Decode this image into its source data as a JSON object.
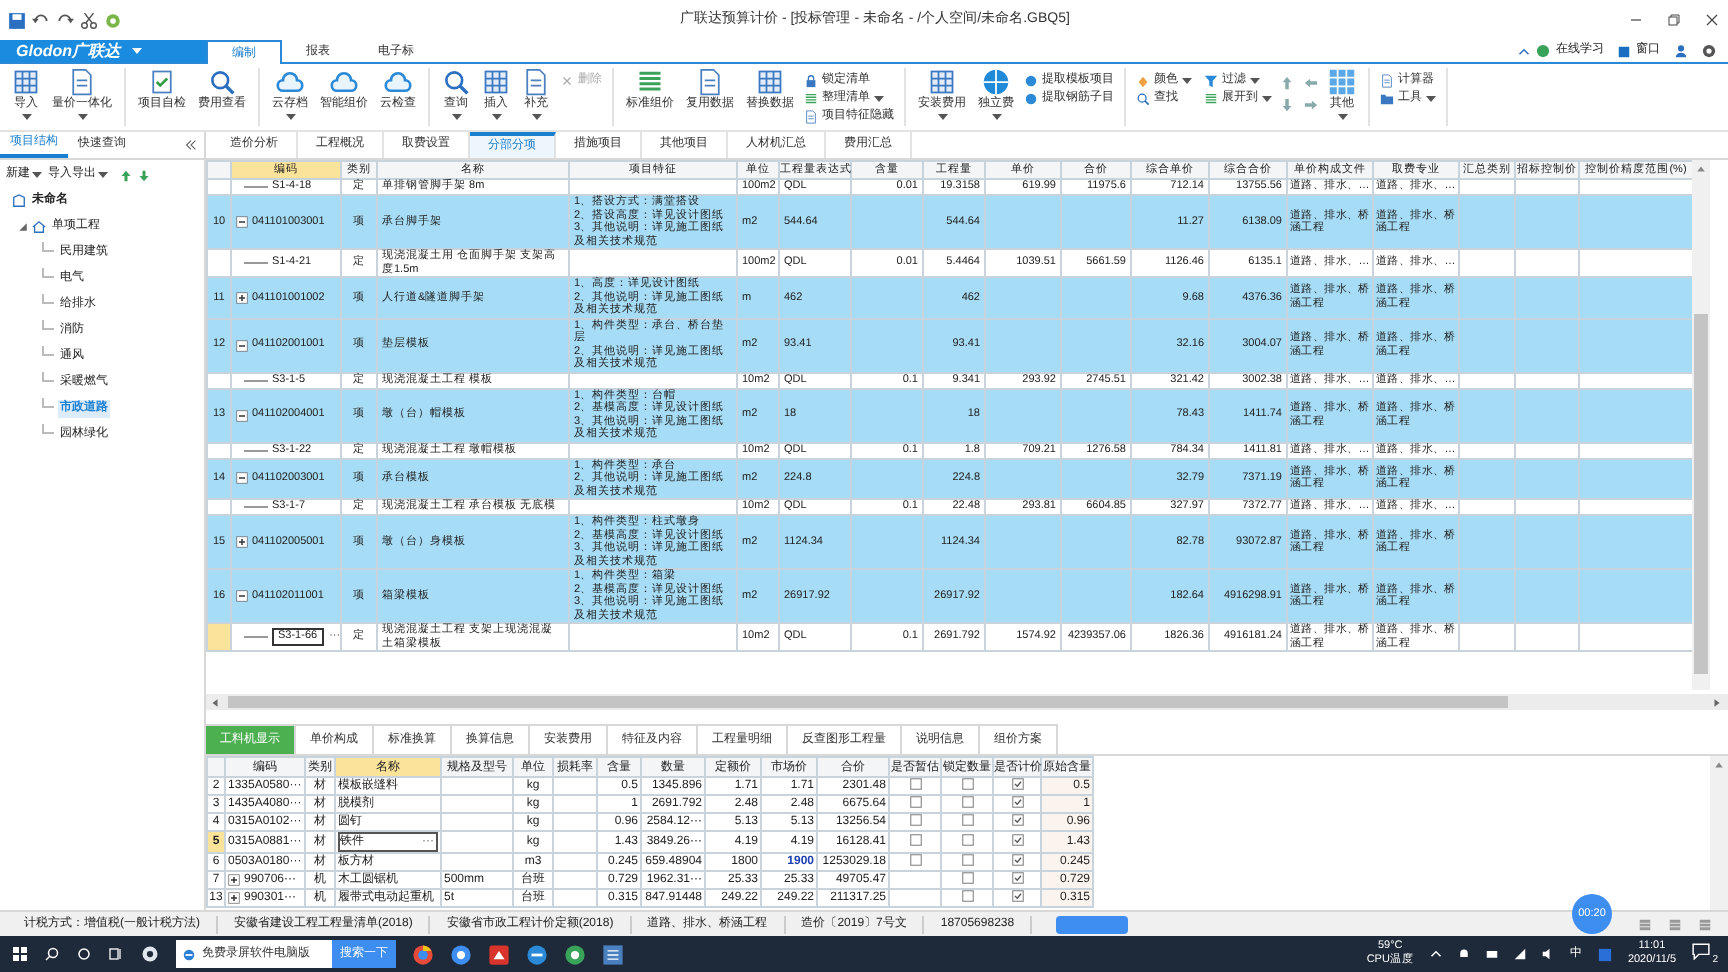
{
  "window": {
    "title": "广联达预算计价 - [投标管理 - 未命名 - /个人空间/未命名.GBQ5]"
  },
  "logo": "Glodon广联达",
  "menu_tabs": [
    {
      "label": "编制",
      "selected": true
    },
    {
      "label": "报表",
      "selected": false
    },
    {
      "label": "电子标",
      "selected": false
    }
  ],
  "help_bar": {
    "online_learning": "在线学习",
    "window_menu": "窗口"
  },
  "ribbon": {
    "groups": [
      {
        "buttons": [
          {
            "label": "导入",
            "kind": "large",
            "dropdown": true,
            "disabled": false
          },
          {
            "label": "量价一体化",
            "kind": "large",
            "dropdown": true,
            "disabled": false
          }
        ]
      },
      {
        "buttons": [
          {
            "label": "项目自检",
            "kind": "large",
            "dropdown": false,
            "disabled": false
          },
          {
            "label": "费用查看",
            "kind": "large",
            "dropdown": false,
            "disabled": false
          }
        ]
      },
      {
        "buttons": [
          {
            "label": "云存档",
            "kind": "large",
            "dropdown": true,
            "disabled": false
          },
          {
            "label": "智能组价",
            "kind": "large",
            "dropdown": false,
            "disabled": false
          },
          {
            "label": "云检查",
            "kind": "large",
            "dropdown": false,
            "disabled": false
          }
        ]
      },
      {
        "buttons": [
          {
            "label": "查询",
            "kind": "large",
            "dropdown": true,
            "disabled": false
          },
          {
            "label": "插入",
            "kind": "large",
            "dropdown": true,
            "disabled": false
          },
          {
            "label": "补充",
            "kind": "large",
            "dropdown": true,
            "disabled": false
          },
          {
            "label": "删除",
            "kind": "small",
            "dropdown": false,
            "disabled": true
          }
        ]
      },
      {
        "buttons": [
          {
            "label": "标准组价",
            "kind": "large",
            "dropdown": false,
            "disabled": false
          },
          {
            "label": "复用数据",
            "kind": "large",
            "dropdown": false,
            "disabled": false
          },
          {
            "label": "替换数据",
            "kind": "large",
            "dropdown": false,
            "disabled": false
          },
          {
            "label": "锁定清单",
            "kind": "small",
            "dropdown": false,
            "disabled": false
          },
          {
            "label": "整理清单",
            "kind": "small",
            "dropdown": true,
            "disabled": false
          },
          {
            "label": "项目特征隐藏",
            "kind": "small",
            "dropdown": false,
            "disabled": false
          }
        ]
      },
      {
        "buttons": [
          {
            "label": "安装费用",
            "kind": "large",
            "dropdown": true,
            "disabled": false
          },
          {
            "label": "独立费",
            "kind": "large",
            "dropdown": true,
            "disabled": false
          },
          {
            "label": "提取模板项目",
            "kind": "small",
            "dropdown": false,
            "disabled": false
          },
          {
            "label": "提取钢筋子目",
            "kind": "small",
            "dropdown": false,
            "disabled": false
          }
        ]
      },
      {
        "buttons": [
          {
            "label": "颜色",
            "kind": "small",
            "dropdown": true,
            "disabled": false
          },
          {
            "label": "查找",
            "kind": "small",
            "dropdown": false,
            "disabled": false
          },
          {
            "label": "过滤",
            "kind": "small",
            "dropdown": true,
            "disabled": false
          },
          {
            "label": "展开到",
            "kind": "small",
            "dropdown": true,
            "disabled": false
          },
          {
            "kind": "arrow_pad"
          },
          {
            "label": "其他",
            "kind": "large",
            "dropdown": true,
            "disabled": false
          }
        ]
      },
      {
        "buttons": [
          {
            "label": "计算器",
            "kind": "small",
            "dropdown": false,
            "disabled": false
          },
          {
            "label": "工具",
            "kind": "small",
            "dropdown": true,
            "disabled": false
          }
        ]
      }
    ]
  },
  "panel_tabs": [
    {
      "label": "项目结构",
      "selected": true
    },
    {
      "label": "快速查询",
      "selected": false
    }
  ],
  "view_tabs": [
    {
      "label": "造价分析",
      "selected": false
    },
    {
      "label": "工程概况",
      "selected": false
    },
    {
      "label": "取费设置",
      "selected": false
    },
    {
      "label": "分部分项",
      "selected": true
    },
    {
      "label": "措施项目",
      "selected": false
    },
    {
      "label": "其他项目",
      "selected": false
    },
    {
      "label": "人材机汇总",
      "selected": false
    },
    {
      "label": "费用汇总",
      "selected": false
    }
  ],
  "tree_toolbar": [
    {
      "label": "新建"
    },
    {
      "label": "导入导出"
    }
  ],
  "tree": {
    "label": "未命名",
    "selected": false,
    "children": [
      {
        "label": "单项工程",
        "selected": false,
        "expanded": true,
        "children": [
          {
            "label": "民用建筑",
            "selected": false
          },
          {
            "label": "电气",
            "selected": false
          },
          {
            "label": "给排水",
            "selected": false
          },
          {
            "label": "消防",
            "selected": false
          },
          {
            "label": "通风",
            "selected": false
          },
          {
            "label": "采暖燃气",
            "selected": false
          },
          {
            "label": "市政道路",
            "selected": true
          },
          {
            "label": "园林绿化",
            "selected": false
          }
        ]
      }
    ]
  },
  "main_table": {
    "columns": [
      {
        "label": "编码",
        "selected": true
      },
      {
        "label": "类别",
        "selected": false
      },
      {
        "label": "名称",
        "selected": false
      },
      {
        "label": "项目特征",
        "selected": false
      },
      {
        "label": "单位",
        "selected": false
      },
      {
        "label": "工程量表达式",
        "selected": false
      },
      {
        "label": "含量",
        "selected": false
      },
      {
        "label": "工程量",
        "selected": false
      },
      {
        "label": "单价",
        "selected": false
      },
      {
        "label": "合价",
        "selected": false
      },
      {
        "label": "综合单价",
        "selected": false
      },
      {
        "label": "综合合价",
        "selected": false
      },
      {
        "label": "单价构成文件",
        "selected": false
      },
      {
        "label": "取费专业",
        "selected": false
      },
      {
        "label": "汇总类别",
        "selected": false
      },
      {
        "label": "招标控制价",
        "selected": false
      },
      {
        "label": "控制价精度范围(%)",
        "selected": false
      }
    ],
    "rows": [
      {
        "kind": "quota",
        "selected": false,
        "code": "S1-4-18",
        "type": "定",
        "name": "单排钢管脚手架 8m",
        "unit": "100m2",
        "expression": "QDL",
        "content": "0.01",
        "quantity": "19.3158",
        "unit_price": "619.99",
        "total": "11975.6",
        "composite_unit_price": "712.14",
        "composite_total": "13755.56",
        "price_file": "道路、排水、…",
        "fee_specialty": "道路、排水、…"
      },
      {
        "kind": "item",
        "selected": false,
        "number": "10",
        "expanded": true,
        "code": "041101003001",
        "type": "项",
        "name": "承台脚手架",
        "features": "1、搭设方式：满堂搭设\n2、搭设高度：详见设计图纸\n3、其他说明：详见施工图纸及相关技术规范",
        "unit": "m2",
        "expression": "544.64",
        "quantity": "544.64",
        "composite_unit_price": "11.27",
        "composite_total": "6138.09",
        "price_file": "道路、排水、桥涵工程",
        "fee_specialty": "道路、排水、桥涵工程"
      },
      {
        "kind": "quota",
        "selected": false,
        "code": "S1-4-21",
        "type": "定",
        "name": "现浇混凝土用 仓面脚手架 支架高度1.5m",
        "unit": "100m2",
        "expression": "QDL",
        "content": "0.01",
        "quantity": "5.4464",
        "unit_price": "1039.51",
        "total": "5661.59",
        "composite_unit_price": "1126.46",
        "composite_total": "6135.1",
        "price_file": "道路、排水、…",
        "fee_specialty": "道路、排水、…"
      },
      {
        "kind": "item",
        "selected": false,
        "number": "11",
        "expanded": false,
        "code": "041101001002",
        "type": "项",
        "name": "人行道&隧道脚手架",
        "features": "1、高度：详见设计图纸\n2、其他说明：详见施工图纸及相关技术规范",
        "unit": "m",
        "expression": "462",
        "quantity": "462",
        "composite_unit_price": "9.68",
        "composite_total": "4376.36",
        "price_file": "道路、排水、桥涵工程",
        "fee_specialty": "道路、排水、桥涵工程"
      },
      {
        "kind": "item",
        "selected": false,
        "number": "12",
        "expanded": true,
        "code": "041102001001",
        "type": "项",
        "name": "垫层模板",
        "features": "1、构件类型：承台、桥台垫层\n2、其他说明：详见施工图纸及相关技术规范",
        "unit": "m2",
        "expression": "93.41",
        "quantity": "93.41",
        "composite_unit_price": "32.16",
        "composite_total": "3004.07",
        "price_file": "道路、排水、桥涵工程",
        "fee_specialty": "道路、排水、桥涵工程"
      },
      {
        "kind": "quota",
        "selected": false,
        "code": "S3-1-5",
        "type": "定",
        "name": "现浇混凝土工程 模板",
        "unit": "10m2",
        "expression": "QDL",
        "content": "0.1",
        "quantity": "9.341",
        "unit_price": "293.92",
        "total": "2745.51",
        "composite_unit_price": "321.42",
        "composite_total": "3002.38",
        "price_file": "道路、排水、…",
        "fee_specialty": "道路、排水、…"
      },
      {
        "kind": "item",
        "selected": false,
        "number": "13",
        "expanded": true,
        "code": "041102004001",
        "type": "项",
        "name": "墩（台）帽模板",
        "features": "1、构件类型：台帽\n2、基模高度：详见设计图纸\n3、其他说明：详见施工图纸及相关技术规范",
        "unit": "m2",
        "expression": "18",
        "quantity": "18",
        "composite_unit_price": "78.43",
        "composite_total": "1411.74",
        "price_file": "道路、排水、桥涵工程",
        "fee_specialty": "道路、排水、桥涵工程"
      },
      {
        "kind": "quota",
        "selected": false,
        "code": "S3-1-22",
        "type": "定",
        "name": "现浇混凝土工程 墩帽模板",
        "unit": "10m2",
        "expression": "QDL",
        "content": "0.1",
        "quantity": "1.8",
        "unit_price": "709.21",
        "total": "1276.58",
        "composite_unit_price": "784.34",
        "composite_total": "1411.81",
        "price_file": "道路、排水、…",
        "fee_specialty": "道路、排水、…"
      },
      {
        "kind": "item",
        "selected": false,
        "number": "14",
        "expanded": true,
        "code": "041102003001",
        "type": "项",
        "name": "承台模板",
        "features": "1、构件类型：承台\n2、其他说明：详见施工图纸及相关技术规范",
        "unit": "m2",
        "expression": "224.8",
        "quantity": "224.8",
        "composite_unit_price": "32.79",
        "composite_total": "7371.19",
        "price_file": "道路、排水、桥涵工程",
        "fee_specialty": "道路、排水、桥涵工程"
      },
      {
        "kind": "quota",
        "selected": false,
        "code": "S3-1-7",
        "type": "定",
        "name": "现浇混凝土工程 承台模板 无底模",
        "unit": "10m2",
        "expression": "QDL",
        "content": "0.1",
        "quantity": "22.48",
        "unit_price": "293.81",
        "total": "6604.85",
        "composite_unit_price": "327.97",
        "composite_total": "7372.77",
        "price_file": "道路、排水、…",
        "fee_specialty": "道路、排水、…"
      },
      {
        "kind": "item",
        "selected": false,
        "number": "15",
        "expanded": false,
        "code": "041102005001",
        "type": "项",
        "name": "墩（台）身模板",
        "features": "1、构件类型：柱式墩身\n2、基模高度：详见设计图纸\n3、其他说明：详见施工图纸及相关技术规范",
        "unit": "m2",
        "expression": "1124.34",
        "quantity": "1124.34",
        "composite_unit_price": "82.78",
        "composite_total": "93072.87",
        "price_file": "道路、排水、桥涵工程",
        "fee_specialty": "道路、排水、桥涵工程"
      },
      {
        "kind": "item",
        "selected": false,
        "number": "16",
        "expanded": true,
        "code": "041102011001",
        "type": "项",
        "name": "箱梁模板",
        "features": "1、构件类型：箱梁\n2、基模高度：详见设计图纸\n3、其他说明：详见施工图纸及相关技术规范",
        "unit": "m2",
        "expression": "26917.92",
        "quantity": "26917.92",
        "composite_unit_price": "182.64",
        "composite_total": "4916298.91",
        "price_file": "道路、排水、桥涵工程",
        "fee_specialty": "道路、排水、桥涵工程"
      },
      {
        "kind": "quota",
        "selected": true,
        "code": "S3-1-66",
        "edit_button": "···",
        "type": "定",
        "name": "现浇混凝土工程 支架上现浇混凝土箱梁模板",
        "unit": "10m2",
        "expression": "QDL",
        "content": "0.1",
        "quantity": "2691.792",
        "unit_price": "1574.92",
        "total": "4239357.06",
        "composite_unit_price": "1826.36",
        "composite_total": "4916181.24",
        "price_file": "道路、排水、桥涵工程",
        "fee_specialty": "道路、排水、桥涵工程"
      }
    ]
  },
  "bottom_tabs": [
    {
      "label": "工料机显示",
      "selected": true
    },
    {
      "label": "单价构成",
      "selected": false
    },
    {
      "label": "标准换算",
      "selected": false
    },
    {
      "label": "换算信息",
      "selected": false
    },
    {
      "label": "安装费用",
      "selected": false
    },
    {
      "label": "特征及内容",
      "selected": false
    },
    {
      "label": "工程量明细",
      "selected": false
    },
    {
      "label": "反查图形工程量",
      "selected": false
    },
    {
      "label": "说明信息",
      "selected": false
    },
    {
      "label": "组价方案",
      "selected": false
    }
  ],
  "resource_table": {
    "columns": [
      {
        "label": "编码",
        "selected": false
      },
      {
        "label": "类别",
        "selected": false
      },
      {
        "label": "名称",
        "selected": true
      },
      {
        "label": "规格及型号",
        "selected": false
      },
      {
        "label": "单位",
        "selected": false
      },
      {
        "label": "损耗率",
        "selected": false
      },
      {
        "label": "含量",
        "selected": false
      },
      {
        "label": "数量",
        "selected": false
      },
      {
        "label": "定额价",
        "selected": false
      },
      {
        "label": "市场价",
        "selected": false
      },
      {
        "label": "合价",
        "selected": false
      },
      {
        "label": "是否暂估",
        "selected": false
      },
      {
        "label": "锁定数量",
        "selected": false
      },
      {
        "label": "是否计价",
        "selected": false
      },
      {
        "label": "原始含量",
        "selected": false
      }
    ],
    "rows": [
      {
        "number": "2",
        "selected": false,
        "code": "1335A0580···",
        "type": "材",
        "name": "模板嵌缝料",
        "unit": "kg",
        "content": "0.5",
        "quantity": "1345.896",
        "quota_price": "1.71",
        "market_price": "1.71",
        "price_changed": false,
        "total": "2301.48",
        "provisional": false,
        "locked": false,
        "priced": true,
        "original_content": "0.5"
      },
      {
        "number": "3",
        "selected": false,
        "code": "1435A4080···",
        "type": "材",
        "name": "脱模剂",
        "unit": "kg",
        "content": "1",
        "quantity": "2691.792",
        "quota_price": "2.48",
        "market_price": "2.48",
        "price_changed": false,
        "total": "6675.64",
        "provisional": false,
        "locked": false,
        "priced": true,
        "original_content": "1"
      },
      {
        "number": "4",
        "selected": false,
        "code": "0315A0102···",
        "type": "材",
        "name": "圆钉",
        "unit": "kg",
        "content": "0.96",
        "quantity": "2584.12···",
        "quota_price": "5.13",
        "market_price": "5.13",
        "price_changed": false,
        "total": "13256.54",
        "provisional": false,
        "locked": false,
        "priced": true,
        "original_content": "0.96"
      },
      {
        "number": "5",
        "selected": true,
        "code": "0315A0881···",
        "type": "材",
        "name": "铁件",
        "edit_button": "···",
        "unit": "kg",
        "content": "1.43",
        "quantity": "3849.26···",
        "quota_price": "4.19",
        "market_price": "4.19",
        "price_changed": false,
        "total": "16128.41",
        "provisional": false,
        "locked": false,
        "priced": true,
        "original_content": "1.43"
      },
      {
        "number": "6",
        "selected": false,
        "code": "0503A0180···",
        "type": "材",
        "name": "板方材",
        "unit": "m3",
        "content": "0.245",
        "quantity": "659.48904",
        "quota_price": "1800",
        "market_price": "1900",
        "price_changed": true,
        "total": "1253029.18",
        "provisional": false,
        "locked": false,
        "priced": true,
        "original_content": "0.245"
      },
      {
        "number": "7",
        "selected": false,
        "expanded": false,
        "code": "990706···",
        "type": "机",
        "name": "木工圆锯机",
        "spec": "500mm",
        "unit": "台班",
        "content": "0.729",
        "quantity": "1962.31···",
        "quota_price": "25.33",
        "market_price": "25.33",
        "price_changed": false,
        "total": "49705.47",
        "locked": false,
        "priced": true,
        "original_content": "0.729"
      },
      {
        "number": "13",
        "selected": false,
        "expanded": false,
        "code": "990301···",
        "type": "机",
        "name": "履带式电动起重机",
        "spec": "5t",
        "unit": "台班",
        "content": "0.315",
        "quantity": "847.91448",
        "quota_price": "249.22",
        "market_price": "249.22",
        "price_changed": false,
        "total": "211317.25",
        "locked": false,
        "priced": true,
        "original_content": "0.315"
      }
    ]
  },
  "status_bar": [
    "计税方式：增值税(一般计税方法)",
    "安徽省建设工程工程量清单(2018)",
    "安徽省市政工程计价定额(2018)",
    "道路、排水、桥涵工程",
    "造价〔2019〕7号文",
    "18705698238"
  ],
  "timer": "00:20",
  "taskbar": {
    "search_value": "免费录屏软件电脑版",
    "search_button": "搜索一下",
    "temperature": "59°C",
    "temperature_label": "CPU温度",
    "ime": "中",
    "time": "11:01",
    "date": "2020/11/5",
    "notifications": "2"
  }
}
